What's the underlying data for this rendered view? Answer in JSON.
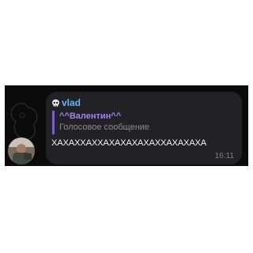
{
  "message": {
    "sender": "vlad",
    "sender_icon": "skull-icon",
    "reply_author": "^^Валентин^^",
    "reply_text": "Голосовое сообщение",
    "text": "ХАХАХХАХХАХАХАХАХАХХАХАХАХА",
    "time": "16:11"
  },
  "colors": {
    "background": "#0b0b0c",
    "bubble": "#222225",
    "sender": "#5fb6f6",
    "reply_accent": "#7b5cd6",
    "reply_author": "#9f84f0"
  }
}
